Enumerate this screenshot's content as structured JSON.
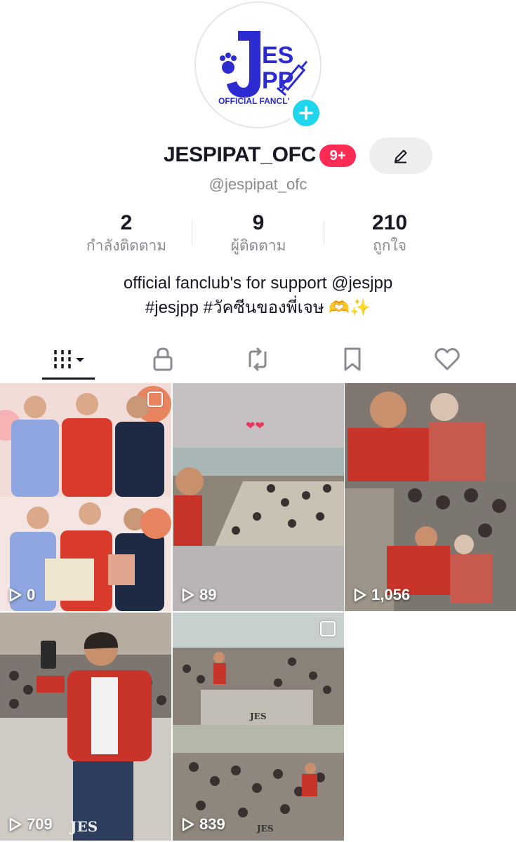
{
  "profile": {
    "logo_text_top": "JES",
    "logo_text_bottom": "PP",
    "logo_caption": "OFFICIAL FANCL",
    "username": "JESPIPAT_OFC",
    "notification_badge": "9+",
    "handle": "@jespipat_ofc"
  },
  "stats": [
    {
      "value": "2",
      "label": "กำลังติดตาม"
    },
    {
      "value": "9",
      "label": "ผู้ติดตาม"
    },
    {
      "value": "210",
      "label": "ถูกใจ"
    }
  ],
  "bio": {
    "line1": "official fanclub's for support @jesjpp",
    "line2": "#jesjpp #วัคซีนของพี่เจษ 🫶✨"
  },
  "tabs": [
    {
      "name": "videos",
      "icon": "grid-bars-icon",
      "active": true
    },
    {
      "name": "private",
      "icon": "lock-icon",
      "active": false
    },
    {
      "name": "reposts",
      "icon": "repost-icon",
      "active": false
    },
    {
      "name": "favorites",
      "icon": "bookmark-icon",
      "active": false
    },
    {
      "name": "liked",
      "icon": "heart-icon",
      "active": false
    }
  ],
  "videos": [
    {
      "views": "0",
      "multi": true
    },
    {
      "views": "89",
      "multi": false
    },
    {
      "views": "1,056",
      "multi": false
    },
    {
      "views": "709",
      "multi": false
    },
    {
      "views": "839",
      "multi": true
    }
  ],
  "watermark": "JES PP",
  "colors": {
    "accent_red": "#fe2c55",
    "plus_cyan": "#20d5ec",
    "logo_blue": "#2b2bd1",
    "text_primary": "#161823",
    "text_secondary": "#8a8b91"
  }
}
